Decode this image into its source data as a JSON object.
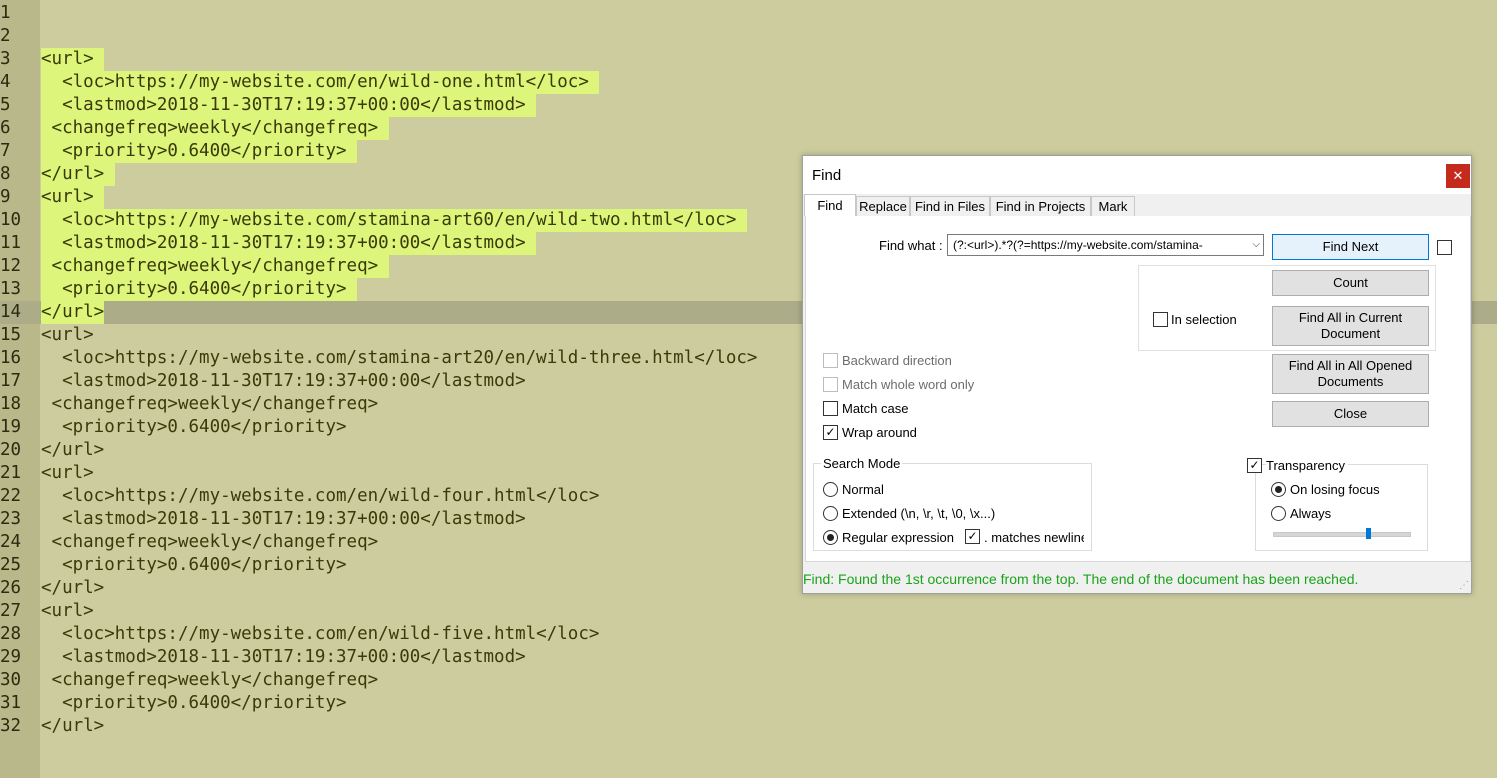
{
  "editor": {
    "lines": [
      {
        "n": "1",
        "text": "",
        "sel": false
      },
      {
        "n": "2",
        "text": "",
        "sel": false
      },
      {
        "n": "3",
        "text": "<url> ",
        "sel": true
      },
      {
        "n": "4",
        "text": "  <loc>https://my-website.com/en/wild-one.html</loc> ",
        "sel": true
      },
      {
        "n": "5",
        "text": "  <lastmod>2018-11-30T17:19:37+00:00</lastmod> ",
        "sel": true
      },
      {
        "n": "6",
        "text": " <changefreq>weekly</changefreq> ",
        "sel": true
      },
      {
        "n": "7",
        "text": "  <priority>0.6400</priority> ",
        "sel": true
      },
      {
        "n": "8",
        "text": "</url> ",
        "sel": true
      },
      {
        "n": "9",
        "text": "<url> ",
        "sel": true
      },
      {
        "n": "10",
        "text": "  <loc>https://my-website.com/stamina-art60/en/wild-two.html</loc> ",
        "sel": true
      },
      {
        "n": "11",
        "text": "  <lastmod>2018-11-30T17:19:37+00:00</lastmod> ",
        "sel": true
      },
      {
        "n": "12",
        "text": " <changefreq>weekly</changefreq> ",
        "sel": true
      },
      {
        "n": "13",
        "text": "  <priority>0.6400</priority> ",
        "sel": true
      },
      {
        "n": "14",
        "text": "</url>",
        "sel": true,
        "current": true
      },
      {
        "n": "15",
        "text": "<url>",
        "sel": false
      },
      {
        "n": "16",
        "text": "  <loc>https://my-website.com/stamina-art20/en/wild-three.html</loc>",
        "sel": false
      },
      {
        "n": "17",
        "text": "  <lastmod>2018-11-30T17:19:37+00:00</lastmod>",
        "sel": false
      },
      {
        "n": "18",
        "text": " <changefreq>weekly</changefreq>",
        "sel": false
      },
      {
        "n": "19",
        "text": "  <priority>0.6400</priority>",
        "sel": false
      },
      {
        "n": "20",
        "text": "</url>",
        "sel": false
      },
      {
        "n": "21",
        "text": "<url>",
        "sel": false
      },
      {
        "n": "22",
        "text": "  <loc>https://my-website.com/en/wild-four.html</loc>",
        "sel": false
      },
      {
        "n": "23",
        "text": "  <lastmod>2018-11-30T17:19:37+00:00</lastmod>",
        "sel": false
      },
      {
        "n": "24",
        "text": " <changefreq>weekly</changefreq>",
        "sel": false
      },
      {
        "n": "25",
        "text": "  <priority>0.6400</priority>",
        "sel": false
      },
      {
        "n": "26",
        "text": "</url>",
        "sel": false
      },
      {
        "n": "27",
        "text": "<url>",
        "sel": false
      },
      {
        "n": "28",
        "text": "  <loc>https://my-website.com/en/wild-five.html</loc>",
        "sel": false
      },
      {
        "n": "29",
        "text": "  <lastmod>2018-11-30T17:19:37+00:00</lastmod>",
        "sel": false
      },
      {
        "n": "30",
        "text": " <changefreq>weekly</changefreq>",
        "sel": false
      },
      {
        "n": "31",
        "text": "  <priority>0.6400</priority>",
        "sel": false
      },
      {
        "n": "32",
        "text": "</url>",
        "sel": false
      }
    ],
    "colors": {
      "background": "#cccc9f",
      "selection": "#dcf57a",
      "current_line": "#acac88"
    }
  },
  "find_dialog": {
    "title": "Find",
    "close_glyph": "✕",
    "tabs": [
      "Find",
      "Replace",
      "Find in Files",
      "Find in Projects",
      "Mark"
    ],
    "active_tab": "Find",
    "find_what_label": "Find what :",
    "find_what_value": "(?:<url>).*?(?=https://my-website.com/stamina-",
    "combo_arrow": "⌵",
    "buttons": {
      "find_next": "Find Next",
      "count": "Count",
      "find_all_current": "Find All in Current Document",
      "find_all_opened": "Find All in All Opened Documents",
      "close": "Close"
    },
    "in_selection_label": "In selection",
    "options": {
      "backward": "Backward direction",
      "whole_word": "Match whole word only",
      "match_case": "Match case",
      "wrap_around": "Wrap around"
    },
    "search_mode": {
      "title": "Search Mode",
      "normal": "Normal",
      "extended": "Extended (\\n, \\r, \\t, \\0, \\x...)",
      "regex": "Regular expression",
      "matches_newline": ". matches newline",
      "selected": "regex"
    },
    "transparency": {
      "label": "Transparency",
      "on_losing_focus": "On losing focus",
      "always": "Always",
      "level": 0.7
    },
    "check_mark": "✓",
    "status": "Find: Found the 1st occurrence from the top. The end of the document has been reached."
  }
}
